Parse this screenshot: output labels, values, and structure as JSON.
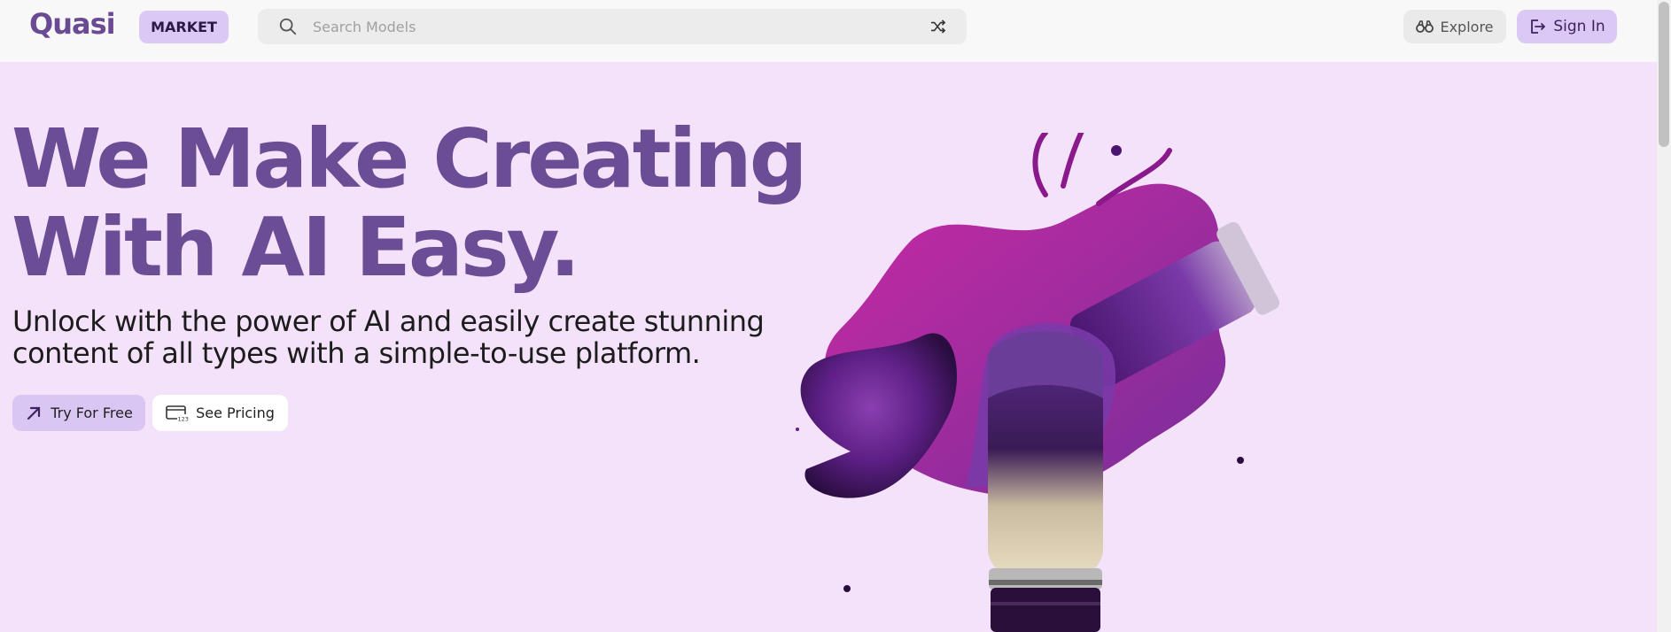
{
  "header": {
    "logo_text": "Quasi",
    "market_label": "MARKET",
    "search": {
      "placeholder": "Search Models",
      "value": ""
    },
    "explore_label": "Explore",
    "signin_label": "Sign In"
  },
  "hero": {
    "title_line1": "We Make Creating",
    "title_line2": "With AI Easy.",
    "subtitle": "Unlock with the power of AI and easily create stunning content of all types with a simple-to-use platform.",
    "try_label": "Try For Free",
    "pricing_label": "See Pricing"
  },
  "icons": {
    "search": "search-icon",
    "shuffle": "shuffle-icon",
    "explore": "binoculars-icon",
    "signin": "sign-in-icon",
    "try": "arrow-up-right-icon",
    "pricing": "pricing-card-icon"
  },
  "colors": {
    "brand_purple": "#6b4d95",
    "hero_background": "#f3e2f9",
    "accent_lavender": "#dcc8f4",
    "header_background": "#f8f8f8"
  }
}
